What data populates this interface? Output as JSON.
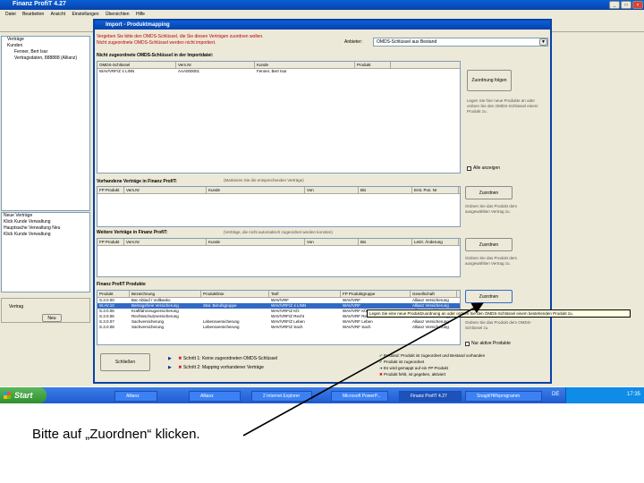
{
  "outer": {
    "title": "Finanz ProfiT 4.27",
    "menu": [
      "Datei",
      "Bearbeiten",
      "Ansicht",
      "Einstellungen",
      "Übersichten",
      "Hilfe"
    ]
  },
  "left_tree": {
    "items": [
      "Verträge",
      "Kunden",
      "Fenner, Bert Isar",
      "Vertragsdaten, 888888 (Allianz)"
    ]
  },
  "left_lower": {
    "items": [
      "Neue Verträge",
      "Klick Kunde Verwaltung",
      "Hauptsache Verwaltung Neu",
      "Klick Kunde Verwaltung"
    ]
  },
  "left_toolbar": {
    "label": "Vertrag",
    "button": "Neu"
  },
  "dialog": {
    "title": "Import - Produktmapping",
    "hint_line1": "Vergeben Sie bitte den OMDS-Schlüssel, die Sie diesen Verträgen zuordnen wollen.",
    "hint_line2": "Nicht zugeordnete OMDS-Schlüssel werden nicht importiert.",
    "anbieter_label": "Anbieter:",
    "anbieter_value": "OMDS-Schlüssel aus Bestand",
    "section1": "Nicht zugeordnete OMDS-Schlüssel in der Importdatei:",
    "table1": {
      "headers": [
        "OMDS-Schlüssel",
        "Vers.Nr",
        "Kunde",
        "Produkt"
      ],
      "rows": [
        [
          "WAV/VRF/Z 4 LINN",
          "AAA000001",
          "Fenner, Bert Isar",
          ""
        ]
      ]
    },
    "btn_zuordnen_folgen": "Zuordnung folgen",
    "note1": "Legen Sie hier neue Produkte an oder ordnen Sie den OMDS-Schlüssel einem Produkt zu.",
    "check1": "Alle anzeigen",
    "section2": "Vorhandene Verträge in Finanz ProfiT:",
    "section2_hint": "(Markieren Sie die entsprechenden Verträge)",
    "table2": {
      "headers": [
        "FP Produkt",
        "Vers.Nr",
        "Kunde",
        "Von",
        "Bis",
        "Erst. Pos. Nr"
      ]
    },
    "btn_zuordnen2": "Zuordnen",
    "note2": "Ordnen Sie das Produkt dem ausgewählten Vertrag zu.",
    "section3": "Weitere Verträge in Finanz ProfiT:",
    "section3_hint": "(Verträge, die nicht automatisch zugeordnet werden konnten)",
    "table3": {
      "headers": [
        "FP Produkt",
        "Vers.Nr",
        "Kunde",
        "Von",
        "Bis",
        "Letzt. Änderung"
      ]
    },
    "btn_zuordnen3": "Zuordnen",
    "note3": "Ordnen Sie das Produkt dem ausgewählten Vertrag zu.",
    "section4": "Finanz ProfiT Produkte",
    "table4": {
      "headers": [
        "Produkt",
        "Bezeichnung",
        "Produktlinie",
        "Tarif",
        "FP Produktgruppe",
        "Gesellschaft"
      ],
      "rows": [
        [
          "S.3.0.00",
          "Bar Ablauf / Vollkasko",
          "",
          "WAV/VRF",
          "WAV/VRF",
          "Allianz Versicherung"
        ],
        [
          "W.AV.10",
          "Beitragsfreie Versicherung",
          "Stat. Berufsgruppe",
          "WAV/VRF/Z 4 LINN",
          "WAV/VRF",
          "Allianz Versicherung"
        ],
        [
          "S.3.0.05",
          "Kraftfahrzeugversicherung",
          "",
          "WAV/VRF/Z Kfz",
          "WAV/VRF Kfz",
          "Allianz Versicherung"
        ],
        [
          "S.3.0.06",
          "Rechtsschutzversicherung",
          "",
          "WAV/VRF/Z Recht",
          "WAV/VRF Recht",
          "Allianz Versicherung"
        ],
        [
          "S.3.0.07",
          "Sachversicherung",
          "Lebensversicherung",
          "WAV/VRF/Z Leben",
          "WAV/VRF Leben",
          "Allianz Versicherung"
        ],
        [
          "S.3.0.08",
          "Sachversicherung",
          "Lebensversicherung",
          "WAV/VRF/Z Sach",
          "WAV/VRF Sach",
          "Allianz Versicherung"
        ]
      ]
    },
    "btn_zuordnen4": "Zuordnen",
    "note4": "Ordnen Sie das Produkt dem OMDS-Schlüssel zu.",
    "tooltip": "Legen Sie eine neue Produktzuordnung an oder ordnen Sie den OMDS-Schlüssel einem bestehenden Produkt zu.",
    "check2": "Nur aktive Produkte",
    "btn_schliessen": "Schließen",
    "step1": "Schritt 1: Keine zugeordneten OMDS-Schlüssel",
    "step2": "Schritt 2: Mapping vorhandener Verträge",
    "legend": [
      "Bestand: Produkt ist zugeordnet und Bestand vorhanden",
      "Produkt ist zugeordnet",
      "Es wird gemappt auf ein FP Produkt",
      "Produkt fehlt, ist gegeben, aktiviert"
    ]
  },
  "taskbar": {
    "start": "Start",
    "items": [
      "Allianz",
      "Allianz",
      "2 Internet Explorer",
      "Microsoft PowerP...",
      "Finanz ProfiT 4.27",
      "Snagit/Hilfsprogramm"
    ],
    "lang": "DE",
    "clock": "17:35"
  },
  "caption": "Bitte auf „Zuordnen“ klicken."
}
